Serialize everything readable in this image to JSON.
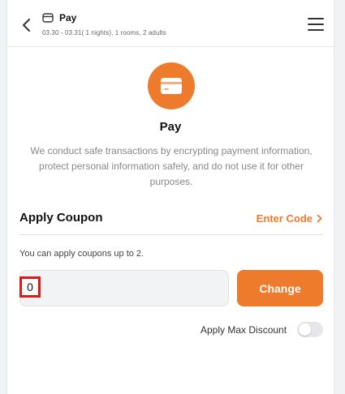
{
  "header": {
    "title": "Pay",
    "subtitle": "03.30 - 03.31( 1 nights), 1 rooms, 2 adults",
    "back_icon": "chevron-left-icon",
    "menu_icon": "hamburger-menu-icon",
    "title_icon": "credit-card-icon"
  },
  "pay": {
    "icon": "credit-card-icon",
    "title": "Pay",
    "description": "We conduct safe transactions by encrypting payment information, protect personal information safely, and do not use it for other purposes."
  },
  "coupon": {
    "section_title": "Apply Coupon",
    "enter_code_label": "Enter Code",
    "note": "You can apply coupons up to 2.",
    "value": "0",
    "change_label": "Change",
    "max_discount_label": "Apply Max Discount",
    "max_discount_on": false
  },
  "colors": {
    "accent": "#ee7a2c",
    "highlight": "#e01818"
  }
}
